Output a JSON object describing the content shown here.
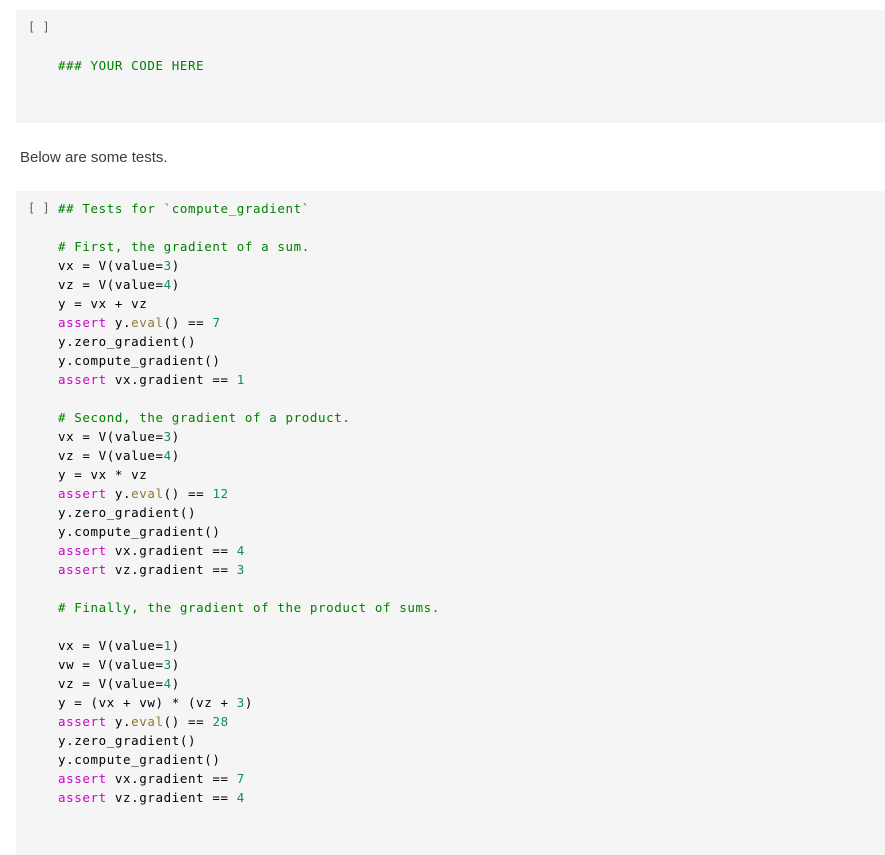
{
  "cells": [
    {
      "type": "code",
      "prompt": "[ ]",
      "lines": [
        {
          "tokens": [
            {
              "t": "### YOUR CODE HERE",
              "c": "c"
            }
          ]
        }
      ]
    },
    {
      "type": "markdown",
      "text": "Below are some tests."
    },
    {
      "type": "code",
      "prompt": "[ ]",
      "lines": [
        {
          "tokens": [
            {
              "t": "## Tests for `compute_gradient`",
              "c": "c"
            }
          ]
        },
        {
          "tokens": []
        },
        {
          "tokens": [
            {
              "t": "# First, the gradient of a sum.",
              "c": "c"
            }
          ]
        },
        {
          "tokens": [
            {
              "t": "vx = V(value=",
              "c": ""
            },
            {
              "t": "3",
              "c": "n"
            },
            {
              "t": ")",
              "c": ""
            }
          ]
        },
        {
          "tokens": [
            {
              "t": "vz = V(value=",
              "c": ""
            },
            {
              "t": "4",
              "c": "n"
            },
            {
              "t": ")",
              "c": ""
            }
          ]
        },
        {
          "tokens": [
            {
              "t": "y = vx + vz",
              "c": ""
            }
          ]
        },
        {
          "tokens": [
            {
              "t": "assert",
              "c": "kw"
            },
            {
              "t": " y.",
              "c": ""
            },
            {
              "t": "eval",
              "c": "fn"
            },
            {
              "t": "() == ",
              "c": ""
            },
            {
              "t": "7",
              "c": "n"
            }
          ]
        },
        {
          "tokens": [
            {
              "t": "y.zero_gradient()",
              "c": ""
            }
          ]
        },
        {
          "tokens": [
            {
              "t": "y.compute_gradient()",
              "c": ""
            }
          ]
        },
        {
          "tokens": [
            {
              "t": "assert",
              "c": "kw"
            },
            {
              "t": " vx.gradient == ",
              "c": ""
            },
            {
              "t": "1",
              "c": "n"
            }
          ]
        },
        {
          "tokens": []
        },
        {
          "tokens": [
            {
              "t": "# Second, the gradient of a product.",
              "c": "c"
            }
          ]
        },
        {
          "tokens": [
            {
              "t": "vx = V(value=",
              "c": ""
            },
            {
              "t": "3",
              "c": "n"
            },
            {
              "t": ")",
              "c": ""
            }
          ]
        },
        {
          "tokens": [
            {
              "t": "vz = V(value=",
              "c": ""
            },
            {
              "t": "4",
              "c": "n"
            },
            {
              "t": ")",
              "c": ""
            }
          ]
        },
        {
          "tokens": [
            {
              "t": "y = vx * vz",
              "c": ""
            }
          ]
        },
        {
          "tokens": [
            {
              "t": "assert",
              "c": "kw"
            },
            {
              "t": " y.",
              "c": ""
            },
            {
              "t": "eval",
              "c": "fn"
            },
            {
              "t": "() == ",
              "c": ""
            },
            {
              "t": "12",
              "c": "n"
            }
          ]
        },
        {
          "tokens": [
            {
              "t": "y.zero_gradient()",
              "c": ""
            }
          ]
        },
        {
          "tokens": [
            {
              "t": "y.compute_gradient()",
              "c": ""
            }
          ]
        },
        {
          "tokens": [
            {
              "t": "assert",
              "c": "kw"
            },
            {
              "t": " vx.gradient == ",
              "c": ""
            },
            {
              "t": "4",
              "c": "n"
            }
          ]
        },
        {
          "tokens": [
            {
              "t": "assert",
              "c": "kw"
            },
            {
              "t": " vz.gradient == ",
              "c": ""
            },
            {
              "t": "3",
              "c": "n"
            }
          ]
        },
        {
          "tokens": []
        },
        {
          "tokens": [
            {
              "t": "# Finally, the gradient of the product of sums.",
              "c": "c"
            }
          ]
        },
        {
          "tokens": []
        },
        {
          "tokens": [
            {
              "t": "vx = V(value=",
              "c": ""
            },
            {
              "t": "1",
              "c": "n"
            },
            {
              "t": ")",
              "c": ""
            }
          ]
        },
        {
          "tokens": [
            {
              "t": "vw = V(value=",
              "c": ""
            },
            {
              "t": "3",
              "c": "n"
            },
            {
              "t": ")",
              "c": ""
            }
          ]
        },
        {
          "tokens": [
            {
              "t": "vz = V(value=",
              "c": ""
            },
            {
              "t": "4",
              "c": "n"
            },
            {
              "t": ")",
              "c": ""
            }
          ]
        },
        {
          "tokens": [
            {
              "t": "y = (vx + vw) * (vz + ",
              "c": ""
            },
            {
              "t": "3",
              "c": "n"
            },
            {
              "t": ")",
              "c": ""
            }
          ]
        },
        {
          "tokens": [
            {
              "t": "assert",
              "c": "kw"
            },
            {
              "t": " y.",
              "c": ""
            },
            {
              "t": "eval",
              "c": "fn"
            },
            {
              "t": "() == ",
              "c": ""
            },
            {
              "t": "28",
              "c": "n"
            }
          ]
        },
        {
          "tokens": [
            {
              "t": "y.zero_gradient()",
              "c": ""
            }
          ]
        },
        {
          "tokens": [
            {
              "t": "y.compute_gradient()",
              "c": ""
            }
          ]
        },
        {
          "tokens": [
            {
              "t": "assert",
              "c": "kw"
            },
            {
              "t": " vx.gradient == ",
              "c": ""
            },
            {
              "t": "7",
              "c": "n"
            }
          ]
        },
        {
          "tokens": [
            {
              "t": "assert",
              "c": "kw"
            },
            {
              "t": " vz.gradient == ",
              "c": ""
            },
            {
              "t": "4",
              "c": "n"
            }
          ]
        },
        {
          "tokens": []
        },
        {
          "tokens": []
        }
      ]
    }
  ],
  "colors": {
    "cell_background": "#f5f5f5",
    "page_background": "#ffffff",
    "comment": "#008000",
    "number": "#0e8a72",
    "keyword": "#cc00cc",
    "function": "#8f7a33",
    "markdown_text": "#3c3c3c",
    "prompt_text": "#5f5f5f"
  }
}
